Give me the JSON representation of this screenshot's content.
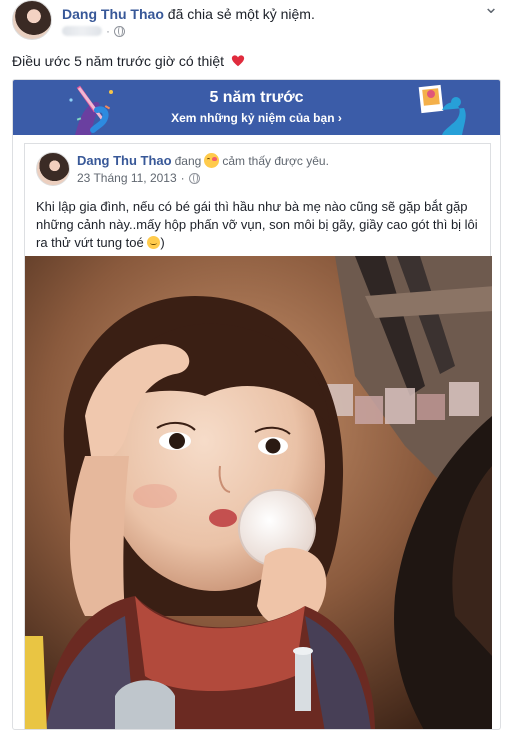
{
  "post": {
    "author": "Dang Thu Thao",
    "action": "đã chia sẻ một kỷ niệm.",
    "caption": "Điều ước 5 năm trước giờ có thiệt",
    "options_icon": "chevron-down-icon",
    "privacy_icon": "globe-icon"
  },
  "memory_banner": {
    "title": "5 năm trước",
    "link": "Xem những kỷ niệm của bạn ›",
    "background": "#3b5ca8"
  },
  "original_post": {
    "author": "Dang Thu Thao",
    "feeling_prefix": "đang",
    "feeling": "cảm thấy được yêu.",
    "date": "23 Tháng 11, 2013",
    "body": "Khi lập gia đình, nếu có bé gái thì hầu như bà mẹ nào cũng sẽ gặp bắt gặp những cảnh này..mấy hộp phấn vỡ vụn, son môi bị gãy, giầy cao gót thì bị lôi ra thử vứt tung toé",
    "body_end": ")"
  },
  "colors": {
    "link": "#385898",
    "text": "#1d2129",
    "muted": "#606770"
  }
}
